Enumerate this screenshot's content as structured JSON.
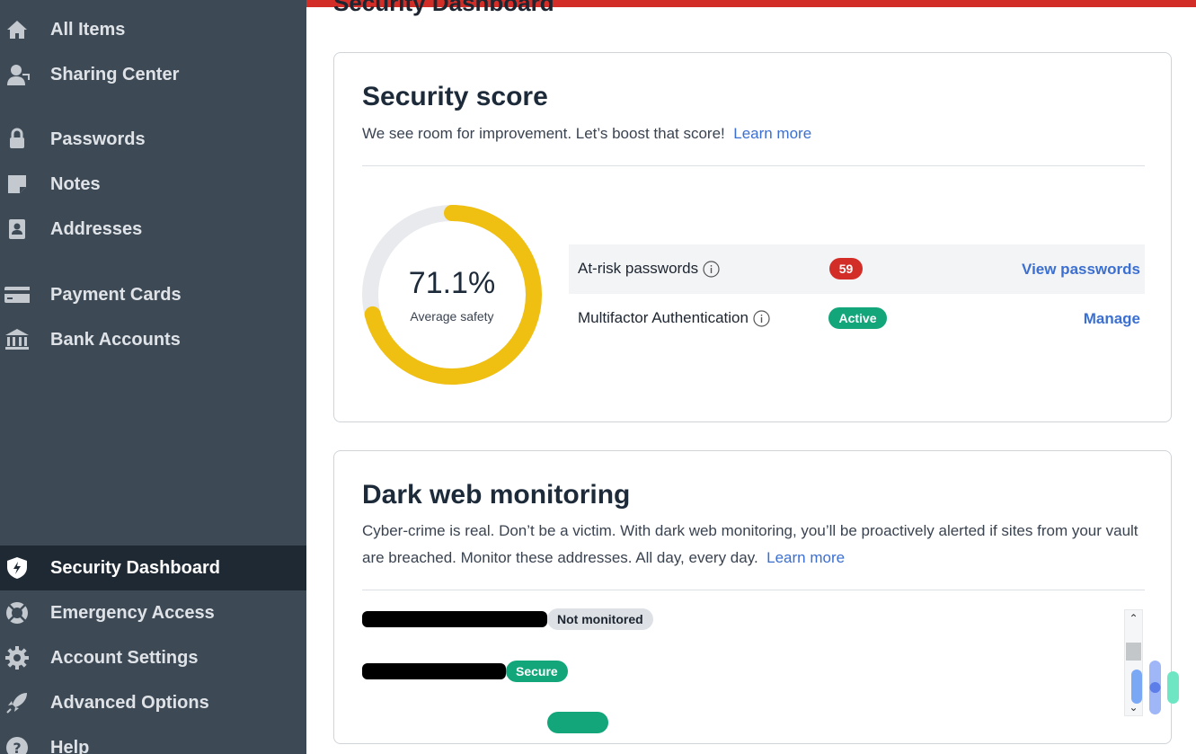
{
  "sidebar": {
    "items": [
      {
        "label": "All Items",
        "icon": "home-icon"
      },
      {
        "label": "Sharing Center",
        "icon": "user-share-icon"
      },
      {
        "label": "Passwords",
        "icon": "lock-icon"
      },
      {
        "label": "Notes",
        "icon": "note-icon"
      },
      {
        "label": "Addresses",
        "icon": "address-book-icon"
      },
      {
        "label": "Payment Cards",
        "icon": "credit-card-icon"
      },
      {
        "label": "Bank Accounts",
        "icon": "bank-icon"
      },
      {
        "label": "Security Dashboard",
        "icon": "shield-icon",
        "active": true
      },
      {
        "label": "Emergency Access",
        "icon": "lifebuoy-icon"
      },
      {
        "label": "Account Settings",
        "icon": "gear-icon"
      },
      {
        "label": "Advanced Options",
        "icon": "rocket-icon"
      },
      {
        "label": "Help",
        "icon": "help-icon"
      }
    ]
  },
  "header": {
    "title": "Security Dashboard",
    "accent_color": "#d32d27"
  },
  "security_score": {
    "title": "Security score",
    "subtitle": "We see room for improvement. Let’s boost that score!",
    "learn_more": "Learn more",
    "score_text": "71.1%",
    "score_fraction": 0.711,
    "score_caption": "Average safety",
    "ring_color": "#efbf12",
    "track_color": "#e8eaed",
    "rows": [
      {
        "label": "At-risk passwords",
        "badge": "59",
        "badge_color": "#d32d27",
        "action": "View passwords"
      },
      {
        "label": "Multifactor Authentication",
        "badge": "Active",
        "badge_color": "#12a67a",
        "action": "Manage"
      }
    ]
  },
  "dark_web": {
    "title": "Dark web monitoring",
    "description": "Cyber-crime is real. Don’t be a victim. With dark web monitoring, you’ll be proactively alerted if sites from your vault are breached. Monitor these addresses. All day, every day.",
    "learn_more": "Learn more",
    "entries": [
      {
        "status": "Not monitored",
        "status_color": "#dde1e5"
      },
      {
        "status": "Secure",
        "status_color": "#12a67a"
      }
    ]
  }
}
